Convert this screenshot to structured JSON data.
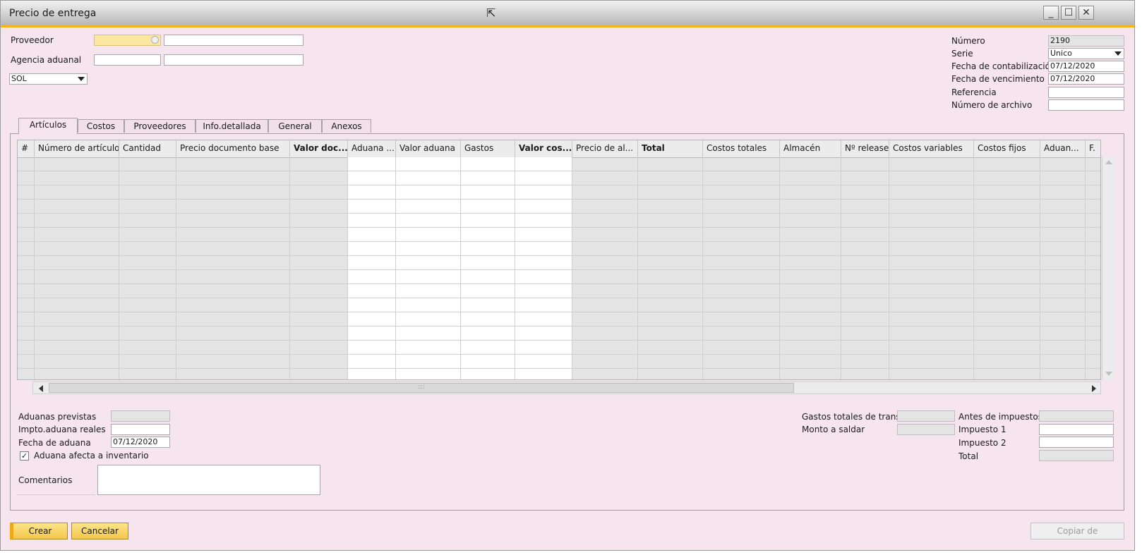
{
  "window": {
    "title": "Precio de entrega",
    "controls": {
      "minimize": "_",
      "maximize": "☐",
      "close": "✕"
    }
  },
  "header_left": {
    "proveedor_label": "Proveedor",
    "agencia_label": "Agencia aduanal",
    "currency_value": "SOL"
  },
  "header_right": {
    "numero_label": "Número",
    "numero_value": "2190",
    "serie_label": "Serie",
    "serie_value": "Unico",
    "fecha_contab_label": "Fecha de contabilización",
    "fecha_contab_value": "07/12/2020",
    "fecha_venc_label": "Fecha de vencimiento",
    "fecha_venc_value": "07/12/2020",
    "referencia_label": "Referencia",
    "numero_archivo_label": "Número de archivo"
  },
  "tabs": [
    {
      "label": "Artículos"
    },
    {
      "label": "Costos"
    },
    {
      "label": "Proveedores"
    },
    {
      "label": "Info.detallada"
    },
    {
      "label": "General"
    },
    {
      "label": "Anexos"
    }
  ],
  "grid": {
    "columns": [
      {
        "label": "#"
      },
      {
        "label": "Número de artículo"
      },
      {
        "label": "Cantidad"
      },
      {
        "label": "Precio documento base"
      },
      {
        "label": "Valor doc..."
      },
      {
        "label": "Aduana ..."
      },
      {
        "label": "Valor aduana"
      },
      {
        "label": "Gastos"
      },
      {
        "label": "Valor cos..."
      },
      {
        "label": "Precio de al..."
      },
      {
        "label": "Total"
      },
      {
        "label": "Costos totales"
      },
      {
        "label": "Almacén"
      },
      {
        "label": "Nº release"
      },
      {
        "label": "Costos variables"
      },
      {
        "label": "Costos fijos"
      },
      {
        "label": "Aduan..."
      },
      {
        "label": "F."
      }
    ],
    "hscroll_grip": ":::"
  },
  "footer_left": {
    "aduanas_previstas_label": "Aduanas previstas",
    "impto_aduana_label": "Impto.aduana reales",
    "fecha_aduana_label": "Fecha de aduana",
    "fecha_aduana_value": "07/12/2020",
    "afecta_inventario_label": "Aduana afecta a inventario",
    "afecta_inventario_checked": true,
    "check_mark": "✓",
    "comentarios_label": "Comentarios"
  },
  "footer_right": {
    "gastos_totales_label": "Gastos totales de transp",
    "monto_saldar_label": "Monto a saldar",
    "antes_impuestos_label": "Antes de impuestos",
    "impuesto1_label": "Impuesto 1",
    "impuesto2_label": "Impuesto 2",
    "total_label": "Total"
  },
  "buttons": {
    "crear": "Crear",
    "cancelar": "Cancelar",
    "copiar_de": "Copiar de"
  },
  "cursor_glyph": "⇱"
}
